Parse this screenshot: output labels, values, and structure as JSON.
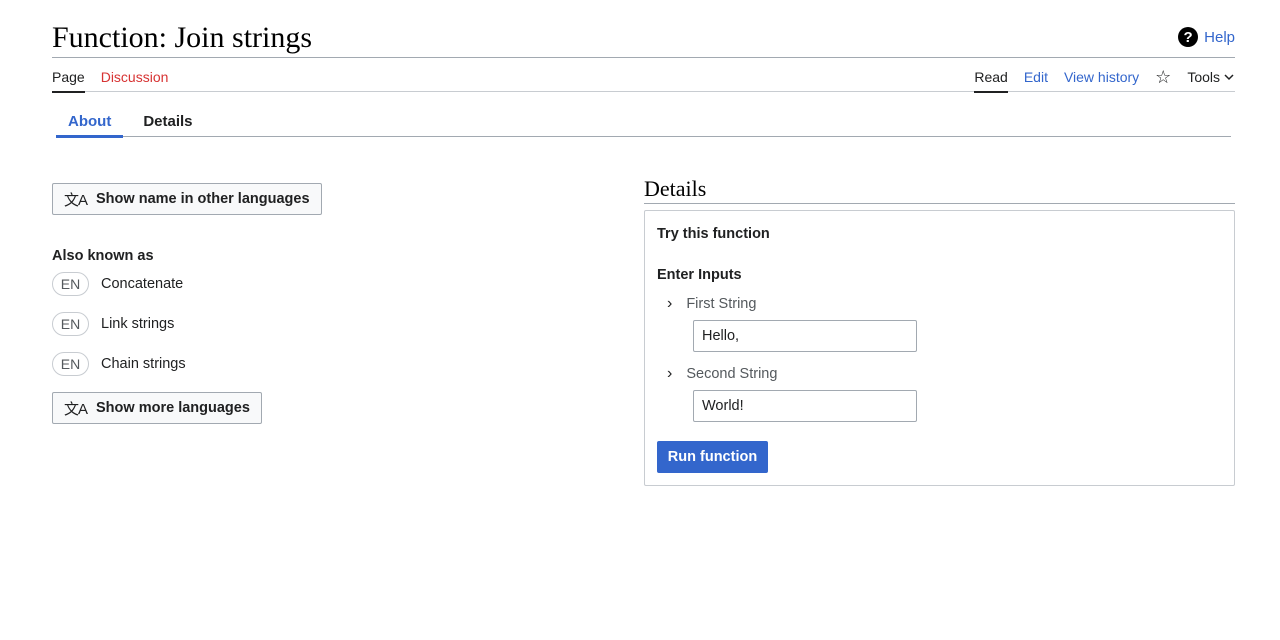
{
  "page": {
    "title": "Function: Join strings"
  },
  "help": {
    "label": "Help",
    "icon": "help-icon"
  },
  "nav": {
    "left": [
      {
        "label": "Page"
      },
      {
        "label": "Discussion"
      }
    ],
    "right": {
      "read": "Read",
      "edit": "Edit",
      "history": "View history",
      "tools": "Tools"
    }
  },
  "tabs": [
    {
      "label": "About"
    },
    {
      "label": "Details"
    }
  ],
  "about": {
    "show_names_button": "Show name in other languages",
    "also_known_as_title": "Also known as",
    "aliases": [
      {
        "lang": "EN",
        "text": "Concatenate"
      },
      {
        "lang": "EN",
        "text": "Link strings"
      },
      {
        "lang": "EN",
        "text": "Chain strings"
      }
    ],
    "show_more_button": "Show more languages"
  },
  "details": {
    "heading": "Details",
    "try_title": "Try this function",
    "enter_inputs_title": "Enter Inputs",
    "inputs": [
      {
        "label": "First String",
        "value": "Hello,"
      },
      {
        "label": "Second String",
        "value": "World!"
      }
    ],
    "run_button": "Run function"
  },
  "colors": {
    "link": "#3366cc",
    "discussion": "#d73333",
    "run_button_bg": "#3366cc"
  }
}
